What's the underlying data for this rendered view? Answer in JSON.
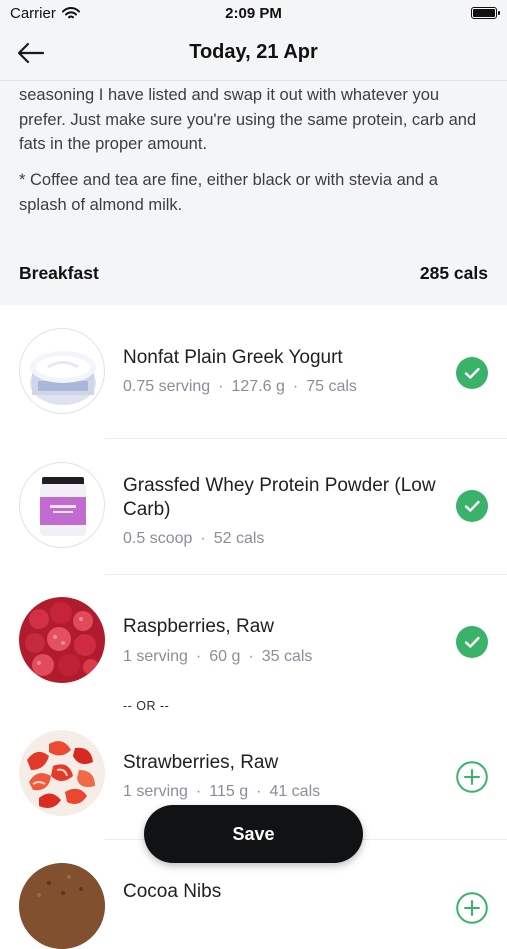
{
  "status_bar": {
    "carrier": "Carrier",
    "time": "2:09 PM"
  },
  "nav": {
    "title": "Today, 21 Apr"
  },
  "notes": {
    "text1": "seasoning I have listed and swap it out with whatever you prefer. Just make sure you're using the same protein, carb and fats in the proper amount.",
    "text2": "* Coffee and tea are fine, either black or with stevia and a splash of almond milk."
  },
  "meal": {
    "name": "Breakfast",
    "calories": "285 cals"
  },
  "items": [
    {
      "name": "Nonfat Plain Greek Yogurt",
      "serving": "0.75 serving",
      "weight": "127.6 g",
      "calories": "75 cals",
      "status": "checked"
    },
    {
      "name": "Grassfed Whey Protein Powder (Low Carb)",
      "serving": "0.5 scoop",
      "calories": "52 cals",
      "status": "checked"
    },
    {
      "name": "Raspberries, Raw",
      "serving": "1 serving",
      "weight": "60 g",
      "calories": "35 cals",
      "status": "checked"
    },
    {
      "name": "Strawberries, Raw",
      "serving": "1 serving",
      "weight": "115 g",
      "calories": "41 cals",
      "status": "add"
    },
    {
      "name": "Cocoa Nibs",
      "status": "add"
    }
  ],
  "or_separator": "-- OR --",
  "save_label": "Save",
  "colors": {
    "accent_green": "#3bb26a",
    "background_gray": "#f4f5f7",
    "save_bg": "#111214"
  },
  "icons": {
    "back": "arrow-left-icon",
    "checked": "check-circle-icon",
    "add": "plus-circle-icon"
  }
}
